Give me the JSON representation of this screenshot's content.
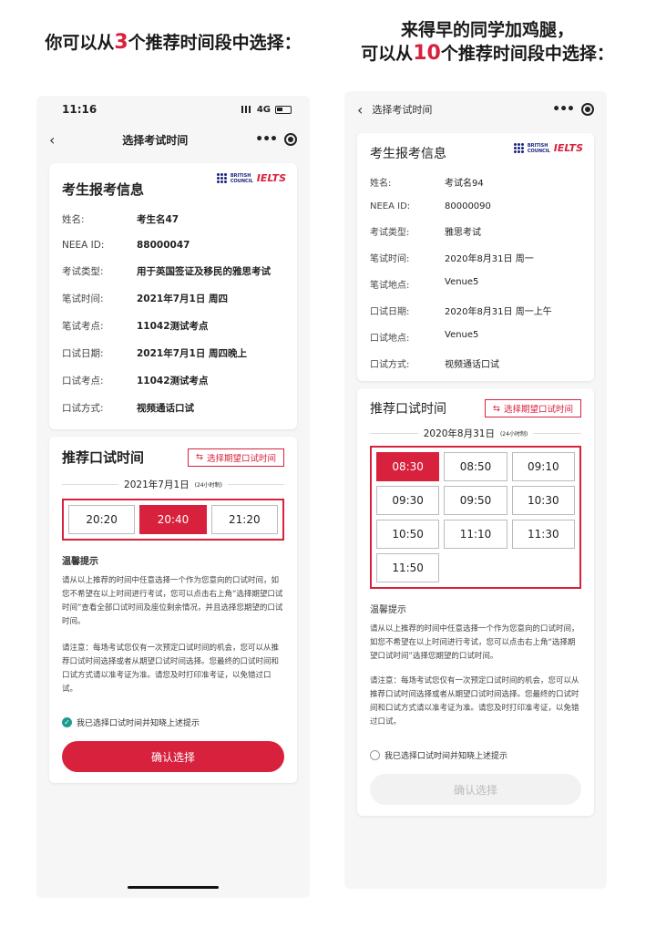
{
  "left_headline": {
    "prefix": "你可以从",
    "num": "3",
    "suffix": "个推荐时间段中选择："
  },
  "right_headline": {
    "line1": "来得早的同学加鸡腿，",
    "prefix": "可以从",
    "num": "10",
    "suffix": "个推荐时间段中选择："
  },
  "left": {
    "status": {
      "time": "11:16",
      "network": "4G"
    },
    "nav_title": "选择考试时间",
    "info_title": "考生报考信息",
    "brand": {
      "bc_line1": "BRITISH",
      "bc_line2": "COUNCIL",
      "ielts": "IELTS"
    },
    "info": [
      {
        "k": "姓名:",
        "v": "考生名47"
      },
      {
        "k": "NEEA ID:",
        "v": "88000047"
      },
      {
        "k": "考试类型:",
        "v": "用于英国签证及移民的雅思考试"
      },
      {
        "k": "笔试时间:",
        "v": "2021年7月1日 周四"
      },
      {
        "k": "笔试考点:",
        "v": "11042测试考点"
      },
      {
        "k": "口试日期:",
        "v": "2021年7月1日 周四晚上"
      },
      {
        "k": "口试考点:",
        "v": "11042测试考点"
      },
      {
        "k": "口试方式:",
        "v": "视频通话口试"
      }
    ],
    "rec_title": "推荐口试时间",
    "pick_label": "选择期望口试时间",
    "date": "2021年7月1日",
    "date_note": "(24小时制)",
    "slots": [
      "20:20",
      "20:40",
      "21:20"
    ],
    "selected": 1,
    "tip_title": "温馨提示",
    "tip1": "请从以上推荐的时间中任意选择一个作为您意向的口试时间，如您不希望在以上时间进行考试，您可以点击右上角“选择期望口试时间”查看全部口试时间及座位剩余情况，并且选择您期望的口试时间。",
    "tip2": "请注意：每场考试您仅有一次预定口试时间的机会，您可以从推荐口试时间选择或者从期望口试时间选择。您最终的口试时间和口试方式请以准考证为准。请您及时打印准考证，以免错过口试。",
    "check_label": "我已选择口试时间并知晓上述提示",
    "checked": true,
    "confirm": "确认选择"
  },
  "right": {
    "nav_title": "选择考试时间",
    "info_title": "考生报考信息",
    "brand": {
      "bc_line1": "BRITISH",
      "bc_line2": "COUNCIL",
      "ielts": "IELTS"
    },
    "info": [
      {
        "k": "姓名:",
        "v": "考试名94"
      },
      {
        "k": "NEEA ID:",
        "v": "80000090"
      },
      {
        "k": "考试类型:",
        "v": "雅思考试"
      },
      {
        "k": "笔试时间:",
        "v": "2020年8月31日 周一"
      },
      {
        "k": "笔试地点:",
        "v": "Venue5"
      },
      {
        "k": "口试日期:",
        "v": "2020年8月31日 周一上午"
      },
      {
        "k": "口试地点:",
        "v": "Venue5"
      },
      {
        "k": "口试方式:",
        "v": "视频通话口试"
      }
    ],
    "rec_title": "推荐口试时间",
    "pick_label": "选择期望口试时间",
    "date": "2020年8月31日",
    "date_note": "(24小时制)",
    "slots": [
      "08:30",
      "08:50",
      "09:10",
      "09:30",
      "09:50",
      "10:30",
      "10:50",
      "11:10",
      "11:30",
      "11:50"
    ],
    "selected": 0,
    "tip_title": "温馨提示",
    "tip1": "请从以上推荐的时间中任意选择一个作为您意向的口试时间，如您不希望在以上时间进行考试，您可以点击右上角“选择期望口试时间”选择您期望的口试时间。",
    "tip2": "请注意：每场考试您仅有一次预定口试时间的机会，您可以从推荐口试时间选择或者从期望口试时间选择。您最终的口试时间和口试方式请以准考证为准。请您及时打印准考证，以免错过口试。",
    "check_label": "我已选择口试时间并知晓上述提示",
    "checked": false,
    "confirm": "确认选择"
  },
  "colors": {
    "accent": "#d8213c",
    "check": "#1a9c8e"
  }
}
